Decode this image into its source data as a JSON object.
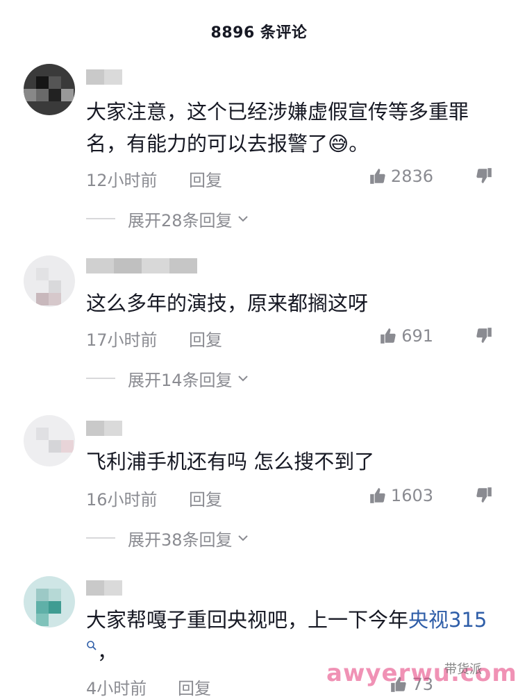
{
  "header": {
    "title": "8896 条评论"
  },
  "comments": [
    {
      "text": "大家注意，这个已经涉嫌虚假宣传等多重罪名，有能力的可以去报警了😅。",
      "time": "12小时前",
      "reply": "回复",
      "likes": "2836",
      "expand": "展开28条回复"
    },
    {
      "text": "这么多年的演技，原来都搁这呀",
      "time": "17小时前",
      "reply": "回复",
      "likes": "691",
      "expand": "展开14条回复"
    },
    {
      "text": "飞利浦手机还有吗 怎么搜不到了",
      "time": "16小时前",
      "reply": "回复",
      "likes": "1603",
      "expand": "展开38条回复"
    },
    {
      "text_before": "大家帮嘎子重回央视吧，上一下今年",
      "text_link": "央视315",
      "text_after": "，",
      "time": "4小时前",
      "reply": "回复",
      "likes": "73"
    }
  ],
  "watermark": {
    "text": "awyerwu.com",
    "badge": "带货派"
  },
  "icons": {
    "like": "thumbs-up-icon",
    "dislike": "thumbs-down-icon",
    "chevron": "chevron-down-icon",
    "search": "search-icon"
  },
  "colors": {
    "link": "#2f5ea8",
    "meta": "#8a8b91",
    "watermark": "#e53a7a"
  }
}
